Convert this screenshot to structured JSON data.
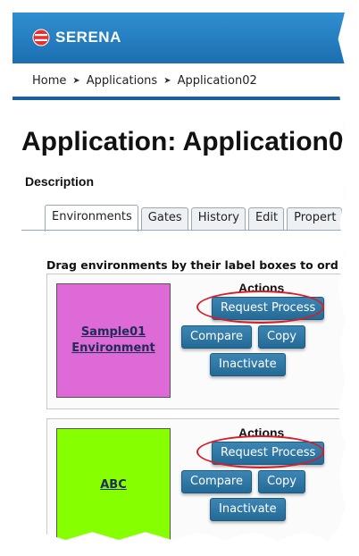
{
  "brand": {
    "logo_text": "SERENA",
    "logo_icon": "serena-logo-icon",
    "bar_color": "#2385c7"
  },
  "breadcrumb": {
    "items": [
      "Home",
      "Applications",
      "Application02"
    ],
    "separator_icon": "chevron-right-icon"
  },
  "page": {
    "title": "Application: Application0",
    "description_label": "Description"
  },
  "tabs": [
    {
      "label": "Environments",
      "active": true
    },
    {
      "label": "Gates",
      "active": false
    },
    {
      "label": "History",
      "active": false
    },
    {
      "label": "Edit",
      "active": false
    },
    {
      "label": "Propert",
      "active": false
    }
  ],
  "environments": {
    "hint": "Drag environments by their label boxes to ord",
    "cards": [
      {
        "name_line1": "Sample01",
        "name_line2": "Environment",
        "color": "#dd6ad6"
      },
      {
        "name_line1": "ABC",
        "name_line2": "",
        "color": "#86ff00"
      }
    ],
    "actions": {
      "title": "Actions",
      "request_process": "Request Process",
      "compare": "Compare",
      "copy": "Copy",
      "inactivate": "Inactivate"
    },
    "highlight_color": "#d41f2a"
  }
}
